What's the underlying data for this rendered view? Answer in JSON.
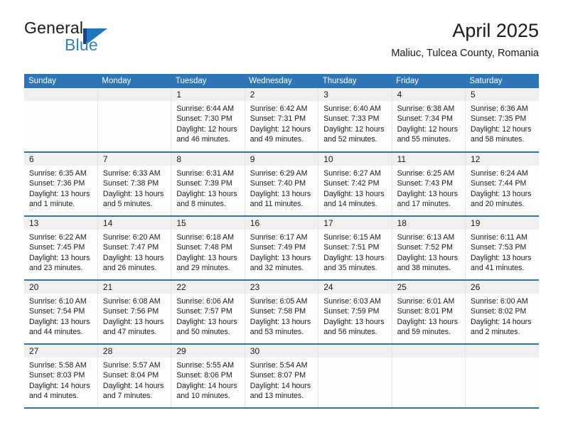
{
  "brand": {
    "name_part1": "General",
    "name_part2": "Blue",
    "mark_color_dark": "#14477d",
    "mark_color_light": "#2176bd"
  },
  "header": {
    "month_title": "April 2025",
    "location": "Maliuc, Tulcea County, Romania"
  },
  "theme": {
    "header_blue": "#2e75b6",
    "daynum_band": "#f0f0f0",
    "cell_bg": "#fdfdfd",
    "text": "#1a1a1a"
  },
  "calendar": {
    "weekday_headers": [
      "Sunday",
      "Monday",
      "Tuesday",
      "Wednesday",
      "Thursday",
      "Friday",
      "Saturday"
    ],
    "weeks": [
      [
        {
          "day": "",
          "lines": []
        },
        {
          "day": "",
          "lines": []
        },
        {
          "day": "1",
          "lines": [
            "Sunrise: 6:44 AM",
            "Sunset: 7:30 PM",
            "Daylight: 12 hours",
            "and 46 minutes."
          ]
        },
        {
          "day": "2",
          "lines": [
            "Sunrise: 6:42 AM",
            "Sunset: 7:31 PM",
            "Daylight: 12 hours",
            "and 49 minutes."
          ]
        },
        {
          "day": "3",
          "lines": [
            "Sunrise: 6:40 AM",
            "Sunset: 7:33 PM",
            "Daylight: 12 hours",
            "and 52 minutes."
          ]
        },
        {
          "day": "4",
          "lines": [
            "Sunrise: 6:38 AM",
            "Sunset: 7:34 PM",
            "Daylight: 12 hours",
            "and 55 minutes."
          ]
        },
        {
          "day": "5",
          "lines": [
            "Sunrise: 6:36 AM",
            "Sunset: 7:35 PM",
            "Daylight: 12 hours",
            "and 58 minutes."
          ]
        }
      ],
      [
        {
          "day": "6",
          "lines": [
            "Sunrise: 6:35 AM",
            "Sunset: 7:36 PM",
            "Daylight: 13 hours",
            "and 1 minute."
          ]
        },
        {
          "day": "7",
          "lines": [
            "Sunrise: 6:33 AM",
            "Sunset: 7:38 PM",
            "Daylight: 13 hours",
            "and 5 minutes."
          ]
        },
        {
          "day": "8",
          "lines": [
            "Sunrise: 6:31 AM",
            "Sunset: 7:39 PM",
            "Daylight: 13 hours",
            "and 8 minutes."
          ]
        },
        {
          "day": "9",
          "lines": [
            "Sunrise: 6:29 AM",
            "Sunset: 7:40 PM",
            "Daylight: 13 hours",
            "and 11 minutes."
          ]
        },
        {
          "day": "10",
          "lines": [
            "Sunrise: 6:27 AM",
            "Sunset: 7:42 PM",
            "Daylight: 13 hours",
            "and 14 minutes."
          ]
        },
        {
          "day": "11",
          "lines": [
            "Sunrise: 6:25 AM",
            "Sunset: 7:43 PM",
            "Daylight: 13 hours",
            "and 17 minutes."
          ]
        },
        {
          "day": "12",
          "lines": [
            "Sunrise: 6:24 AM",
            "Sunset: 7:44 PM",
            "Daylight: 13 hours",
            "and 20 minutes."
          ]
        }
      ],
      [
        {
          "day": "13",
          "lines": [
            "Sunrise: 6:22 AM",
            "Sunset: 7:45 PM",
            "Daylight: 13 hours",
            "and 23 minutes."
          ]
        },
        {
          "day": "14",
          "lines": [
            "Sunrise: 6:20 AM",
            "Sunset: 7:47 PM",
            "Daylight: 13 hours",
            "and 26 minutes."
          ]
        },
        {
          "day": "15",
          "lines": [
            "Sunrise: 6:18 AM",
            "Sunset: 7:48 PM",
            "Daylight: 13 hours",
            "and 29 minutes."
          ]
        },
        {
          "day": "16",
          "lines": [
            "Sunrise: 6:17 AM",
            "Sunset: 7:49 PM",
            "Daylight: 13 hours",
            "and 32 minutes."
          ]
        },
        {
          "day": "17",
          "lines": [
            "Sunrise: 6:15 AM",
            "Sunset: 7:51 PM",
            "Daylight: 13 hours",
            "and 35 minutes."
          ]
        },
        {
          "day": "18",
          "lines": [
            "Sunrise: 6:13 AM",
            "Sunset: 7:52 PM",
            "Daylight: 13 hours",
            "and 38 minutes."
          ]
        },
        {
          "day": "19",
          "lines": [
            "Sunrise: 6:11 AM",
            "Sunset: 7:53 PM",
            "Daylight: 13 hours",
            "and 41 minutes."
          ]
        }
      ],
      [
        {
          "day": "20",
          "lines": [
            "Sunrise: 6:10 AM",
            "Sunset: 7:54 PM",
            "Daylight: 13 hours",
            "and 44 minutes."
          ]
        },
        {
          "day": "21",
          "lines": [
            "Sunrise: 6:08 AM",
            "Sunset: 7:56 PM",
            "Daylight: 13 hours",
            "and 47 minutes."
          ]
        },
        {
          "day": "22",
          "lines": [
            "Sunrise: 6:06 AM",
            "Sunset: 7:57 PM",
            "Daylight: 13 hours",
            "and 50 minutes."
          ]
        },
        {
          "day": "23",
          "lines": [
            "Sunrise: 6:05 AM",
            "Sunset: 7:58 PM",
            "Daylight: 13 hours",
            "and 53 minutes."
          ]
        },
        {
          "day": "24",
          "lines": [
            "Sunrise: 6:03 AM",
            "Sunset: 7:59 PM",
            "Daylight: 13 hours",
            "and 56 minutes."
          ]
        },
        {
          "day": "25",
          "lines": [
            "Sunrise: 6:01 AM",
            "Sunset: 8:01 PM",
            "Daylight: 13 hours",
            "and 59 minutes."
          ]
        },
        {
          "day": "26",
          "lines": [
            "Sunrise: 6:00 AM",
            "Sunset: 8:02 PM",
            "Daylight: 14 hours",
            "and 2 minutes."
          ]
        }
      ],
      [
        {
          "day": "27",
          "lines": [
            "Sunrise: 5:58 AM",
            "Sunset: 8:03 PM",
            "Daylight: 14 hours",
            "and 4 minutes."
          ]
        },
        {
          "day": "28",
          "lines": [
            "Sunrise: 5:57 AM",
            "Sunset: 8:04 PM",
            "Daylight: 14 hours",
            "and 7 minutes."
          ]
        },
        {
          "day": "29",
          "lines": [
            "Sunrise: 5:55 AM",
            "Sunset: 8:06 PM",
            "Daylight: 14 hours",
            "and 10 minutes."
          ]
        },
        {
          "day": "30",
          "lines": [
            "Sunrise: 5:54 AM",
            "Sunset: 8:07 PM",
            "Daylight: 14 hours",
            "and 13 minutes."
          ]
        },
        {
          "day": "",
          "lines": []
        },
        {
          "day": "",
          "lines": []
        },
        {
          "day": "",
          "lines": []
        }
      ]
    ]
  }
}
